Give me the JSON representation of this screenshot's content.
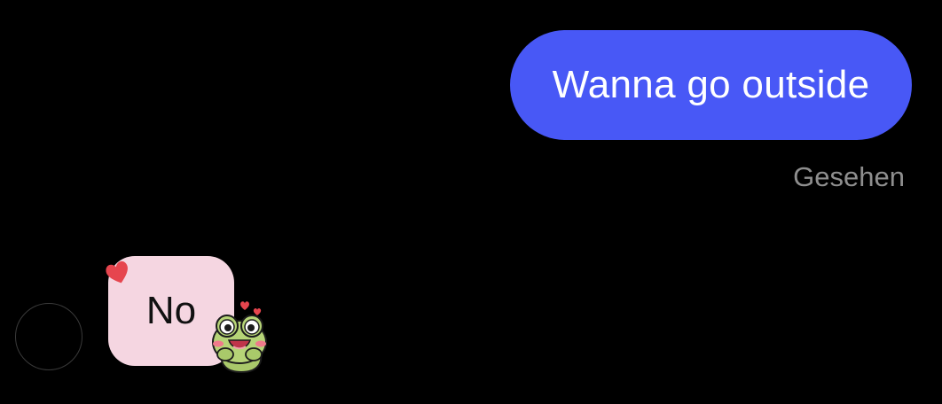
{
  "thread": {
    "messages": [
      {
        "direction": "outgoing",
        "text": "Wanna go outside",
        "bubble_color": "#4858f6"
      },
      {
        "direction": "incoming",
        "text": "No",
        "bubble_color": "#f5d6e1"
      }
    ],
    "seen_status": "Gesehen"
  },
  "icons": {
    "reaction_heart": "heart-icon",
    "frog_sticker": "frog-sticker-icon",
    "avatar": "avatar-placeholder"
  },
  "colors": {
    "background": "#000000",
    "seen_text": "#8e8e8e",
    "heart": "#e6454e",
    "frog": "#a9c96a"
  }
}
